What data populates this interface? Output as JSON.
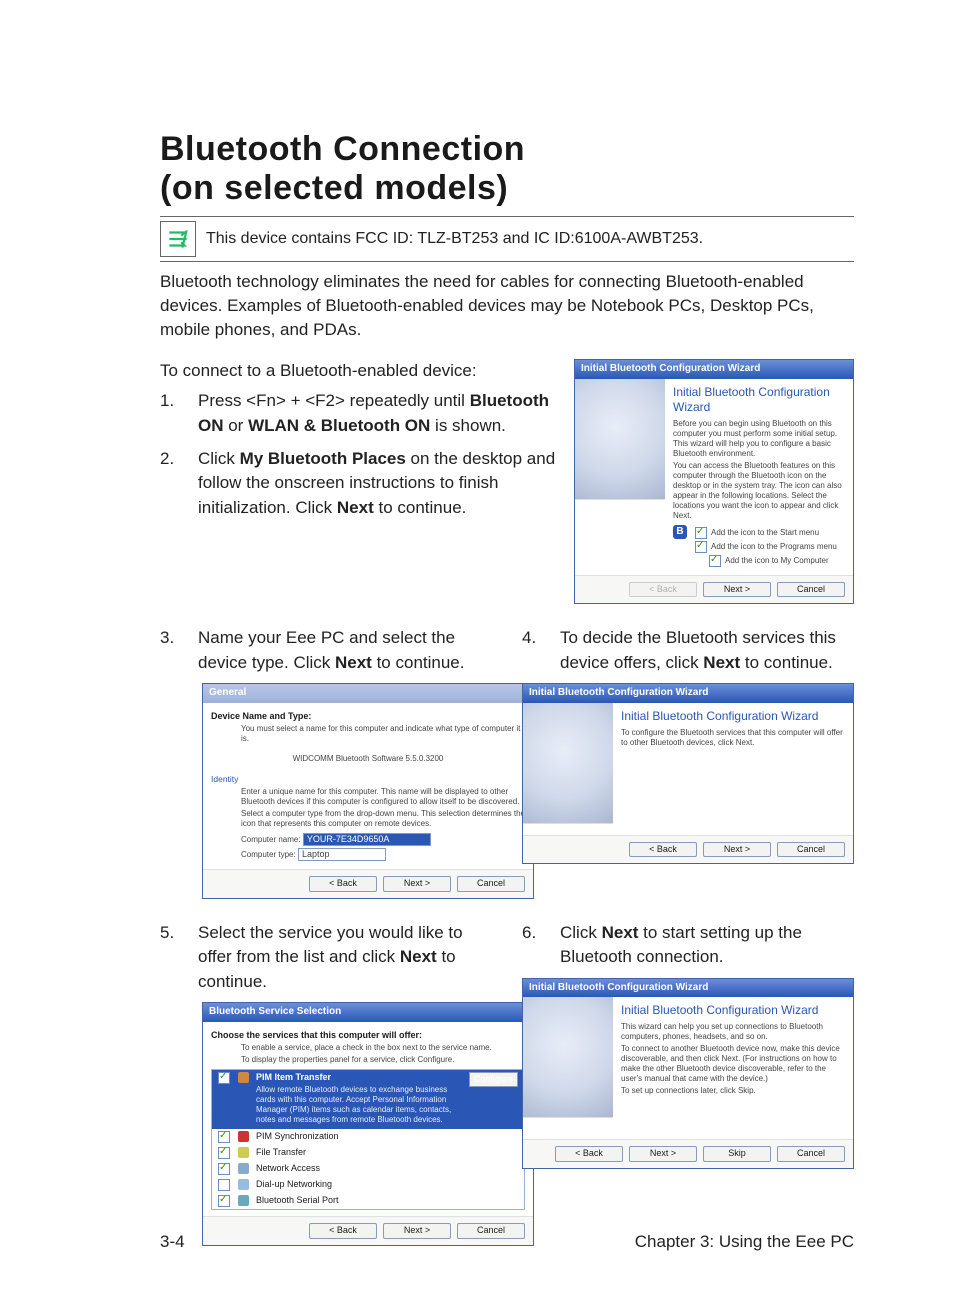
{
  "heading_line1": "Bluetooth Connection",
  "heading_line2": "(on selected models)",
  "note": "This device contains FCC ID: TLZ-BT253 and IC ID:6100A-AWBT253.",
  "intro": "Bluetooth technology eliminates the need for cables for connecting Bluetooth-enabled devices. Examples of Bluetooth-enabled devices may be Notebook PCs, Desktop PCs, mobile phones, and PDAs.",
  "lead": "To connect to a Bluetooth-enabled device:",
  "steps": {
    "s1": {
      "num": "1.",
      "pre": "Press <Fn> + <F2> repeatedly until ",
      "b1": "Bluetooth ON",
      "mid": " or ",
      "b2": "WLAN & Bluetooth ON",
      "post": " is shown."
    },
    "s2": {
      "num": "2.",
      "pre": "Click ",
      "b1": "My Bluetooth Places",
      "mid": " on the desktop and follow the onscreen instructions to finish initialization. Click ",
      "b2": "Next",
      "post": " to continue."
    },
    "s3": {
      "num": "3.",
      "pre": "Name your Eee PC and select the device type. Click ",
      "b1": "Next",
      "post": " to continue."
    },
    "s4": {
      "num": "4.",
      "pre": "To decide the Bluetooth services this device offers, click ",
      "b1": "Next",
      "post": " to continue."
    },
    "s5": {
      "num": "5.",
      "pre": "Select the service you would like to offer from the list and click ",
      "b1": "Next",
      "post": " to continue."
    },
    "s6": {
      "num": "6.",
      "pre": "Click ",
      "b1": "Next",
      "post": " to start setting up the Bluetooth connection."
    }
  },
  "shot1": {
    "titlebar": "Initial Bluetooth Configuration Wizard",
    "wtitle": "Initial Bluetooth Configuration Wizard",
    "desc1": "Before you can begin using Bluetooth on this computer you must perform some initial setup. This wizard will help you to configure a basic Bluetooth environment.",
    "desc2": "You can access the Bluetooth features on this computer through the Bluetooth icon on the desktop or in the system tray. The icon can also appear in the following locations. Select the locations you want the icon to appear and click Next.",
    "cb1": "Add the icon to the Start menu",
    "cb2": "Add the icon to the Programs menu",
    "cb3": "Add the icon to My Computer",
    "back": "< Back",
    "next": "Next >",
    "cancel": "Cancel"
  },
  "shot3": {
    "titlebar": "General",
    "section": "Device Name and Type:",
    "hint1": "You must select a name for this computer and indicate what type of computer it is.",
    "soft": "WIDCOMM Bluetooth Software 5.5.0.3200",
    "identity": "Identity",
    "hint2": "Enter a unique name for this computer. This name will be displayed to other Bluetooth devices if this computer is configured to allow itself to be discovered.",
    "hint3": "Select a computer type from the drop-down menu. This selection determines the icon that represents this computer on remote devices.",
    "name_label": "Computer name:",
    "name_value": "YOUR-7E34D9650A",
    "type_label": "Computer type:",
    "type_value": "Laptop",
    "back": "< Back",
    "next": "Next >",
    "cancel": "Cancel"
  },
  "shot4": {
    "titlebar": "Initial Bluetooth Configuration Wizard",
    "wtitle": "Initial Bluetooth Configuration Wizard",
    "desc": "To configure the Bluetooth services that this computer will offer to other Bluetooth devices, click Next.",
    "back": "< Back",
    "next": "Next >",
    "cancel": "Cancel"
  },
  "shot5": {
    "titlebar": "Bluetooth Service Selection",
    "section": "Choose the services that this computer will offer:",
    "hint1": "To enable a service, place a check in the box next to the service name.",
    "hint2": "To display the properties panel for a service, click Configure.",
    "items": [
      {
        "label": "PIM Item Transfer",
        "desc": "Allow remote Bluetooth devices to exchange business cards with this computer. Accept Personal Information Manager (PIM) items such as calendar items, contacts, notes and messages from remote Bluetooth devices.",
        "selected": true,
        "checked": true
      },
      {
        "label": "PIM Synchronization",
        "checked": true
      },
      {
        "label": "File Transfer",
        "checked": true
      },
      {
        "label": "Network Access",
        "checked": true
      },
      {
        "label": "Dial-up Networking",
        "checked": false
      },
      {
        "label": "Bluetooth Serial Port",
        "checked": true
      }
    ],
    "configure": "Configure",
    "back": "< Back",
    "next": "Next >",
    "cancel": "Cancel"
  },
  "shot6": {
    "titlebar": "Initial Bluetooth Configuration Wizard",
    "wtitle": "Initial Bluetooth Configuration Wizard",
    "desc1": "This wizard can help you set up connections to Bluetooth computers, phones, headsets, and so on.",
    "desc2": "To connect to another Bluetooth device now, make this device discoverable, and then click Next. (For instructions on how to make the other Bluetooth device discoverable, refer to the user's manual that came with the device.)",
    "desc3": "To set up connections later, click Skip.",
    "back": "< Back",
    "next": "Next >",
    "skip": "Skip",
    "cancel": "Cancel"
  },
  "footer": {
    "left": "3-4",
    "right": "Chapter 3: Using the Eee PC"
  }
}
